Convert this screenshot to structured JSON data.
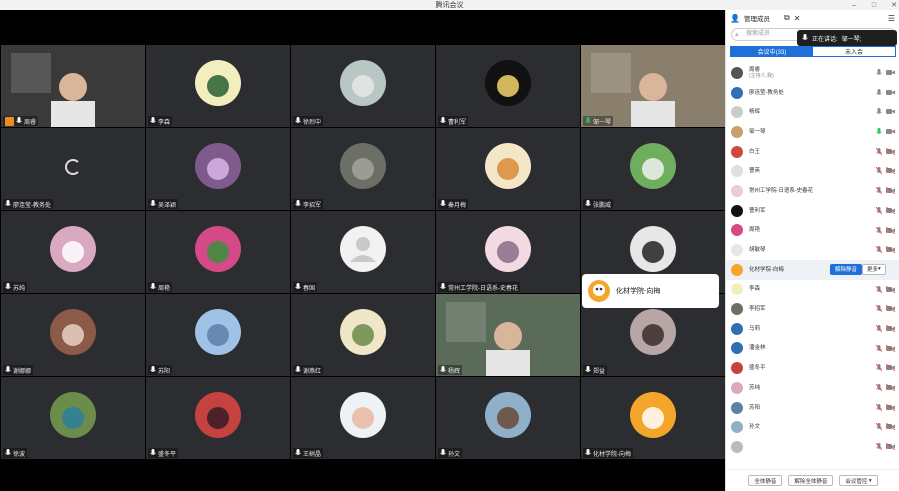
{
  "window": {
    "title": "腾讯会议"
  },
  "tiles": [
    {
      "name": "周睿",
      "kind": "video",
      "bg": "#3a3a3a",
      "host": true
    },
    {
      "name": "李森",
      "kind": "avatar",
      "color": "#f2eec0",
      "accent": "#2a5f2f"
    },
    {
      "name": "徐烈中",
      "kind": "avatar",
      "color": "#b9c7c4",
      "accent": "#e8e8e8"
    },
    {
      "name": "曹利军",
      "kind": "avatar",
      "color": "#111111",
      "accent": "#f4d36b"
    },
    {
      "name": "邹一琴",
      "kind": "video",
      "bg": "#8a7f6c",
      "active": true
    },
    {
      "name": "廖连莹-教务处",
      "kind": "spinner"
    },
    {
      "name": "吴泽颖",
      "kind": "avatar",
      "color": "#7f5a8d",
      "accent": "#d7b6e8"
    },
    {
      "name": "李招军",
      "kind": "avatar",
      "color": "#6c6f66",
      "accent": "#a4a59b"
    },
    {
      "name": "秦月梅",
      "kind": "avatar",
      "color": "#f3e7c8",
      "accent": "#d98b3a"
    },
    {
      "name": "张鹏威",
      "kind": "avatar",
      "color": "#6fae5c",
      "accent": "#f0f0f0"
    },
    {
      "name": "苏纯",
      "kind": "avatar",
      "color": "#d9a9c2",
      "accent": "#ffffff"
    },
    {
      "name": "周艳",
      "kind": "avatar",
      "color": "#d44a86",
      "accent": "#3b8f3d"
    },
    {
      "name": "春国",
      "kind": "default"
    },
    {
      "name": "常州工学院-日语系-史春花",
      "kind": "avatar",
      "color": "#f2d9e2",
      "accent": "#8a6b8a"
    },
    {
      "name": "",
      "kind": "avatar",
      "color": "#e7e7e7",
      "accent": "#222222"
    },
    {
      "name": "谢娜娜",
      "kind": "avatar",
      "color": "#8c5a48",
      "accent": "#e7d2c2"
    },
    {
      "name": "苏阳",
      "kind": "avatar",
      "color": "#9fc3e6",
      "accent": "#5f7ea8"
    },
    {
      "name": "谢燕红",
      "kind": "avatar",
      "color": "#f0e6c8",
      "accent": "#6b8b4a"
    },
    {
      "name": "杨辉",
      "kind": "video",
      "bg": "#5b6b5a"
    },
    {
      "name": "郑益",
      "kind": "avatar",
      "color": "#b8a6a6",
      "accent": "#3b2b2b"
    },
    {
      "name": "徐波",
      "kind": "avatar",
      "color": "#6b8c4a",
      "accent": "#2a7f9f"
    },
    {
      "name": "盛冬平",
      "kind": "avatar",
      "color": "#c4423f",
      "accent": "#3a1a26"
    },
    {
      "name": "王树晶",
      "kind": "avatar",
      "color": "#eef2f6",
      "accent": "#e8b9a0"
    },
    {
      "name": "孙文",
      "kind": "avatar",
      "color": "#8fb0c9",
      "accent": "#6a4a3a"
    },
    {
      "name": "化材学院-向梅",
      "kind": "avatar",
      "color": "#f4a62a",
      "accent": "#ffffff"
    }
  ],
  "popup": {
    "name": "化材学院-向梅"
  },
  "panel": {
    "header": "管理成员",
    "search_placeholder": "搜索成员",
    "speaking_prefix": "正在讲话:",
    "speaking_name": "邹一琴;",
    "tab_in": "会议中(33)",
    "tab_out": "未入会",
    "members": [
      {
        "name": "周睿",
        "sub": "(主持人,我)",
        "color": "#555555",
        "mic": "gray"
      },
      {
        "name": "廖连莹-教务处",
        "color": "#2f6fb5",
        "mic": "gray"
      },
      {
        "name": "杨辉",
        "color": "#cccccc",
        "mic": "gray"
      },
      {
        "name": "邹一琴",
        "color": "#c9a06a",
        "mic": "green"
      },
      {
        "name": "白王",
        "color": "#d04a3b",
        "mic": "muted"
      },
      {
        "name": "曹英",
        "color": "#e0e0e0",
        "mic": "muted"
      },
      {
        "name": "常州工学院-日语系-史春花",
        "color": "#f0c9d6",
        "mic": "muted"
      },
      {
        "name": "曹利军",
        "color": "#111111",
        "mic": "muted"
      },
      {
        "name": "周艳",
        "color": "#d44a86",
        "mic": "muted"
      },
      {
        "name": "胡敏琴",
        "color": "#e7e7e7",
        "mic": "muted"
      },
      {
        "name": "化材学院-向梅",
        "color": "#f4a62a",
        "mic": "muted",
        "selected": true
      },
      {
        "name": "李森",
        "color": "#f2eec0",
        "mic": "muted"
      },
      {
        "name": "李招军",
        "color": "#6c6f66",
        "mic": "muted"
      },
      {
        "name": "马莉",
        "color": "#2f6fb5",
        "mic": "muted"
      },
      {
        "name": "潘金林",
        "color": "#2f6fb5",
        "mic": "muted"
      },
      {
        "name": "盛冬平",
        "color": "#c4423f",
        "mic": "muted"
      },
      {
        "name": "苏纯",
        "color": "#d9a9c2",
        "mic": "muted"
      },
      {
        "name": "苏阳",
        "color": "#5f7ea8",
        "mic": "muted"
      },
      {
        "name": "孙文",
        "color": "#8fb0c9",
        "mic": "muted"
      },
      {
        "name": "",
        "color": "#bbbbbb",
        "mic": "muted"
      }
    ],
    "unmute_label": "解除静音",
    "more_label": "更多",
    "footer": {
      "mute_all": "全体静音",
      "unmute_all": "解除全体静音",
      "manage": "会议管控"
    }
  },
  "colors": {
    "accent": "#1e6fd9",
    "speaking_green": "#27c162",
    "muted_red": "#e04040"
  }
}
